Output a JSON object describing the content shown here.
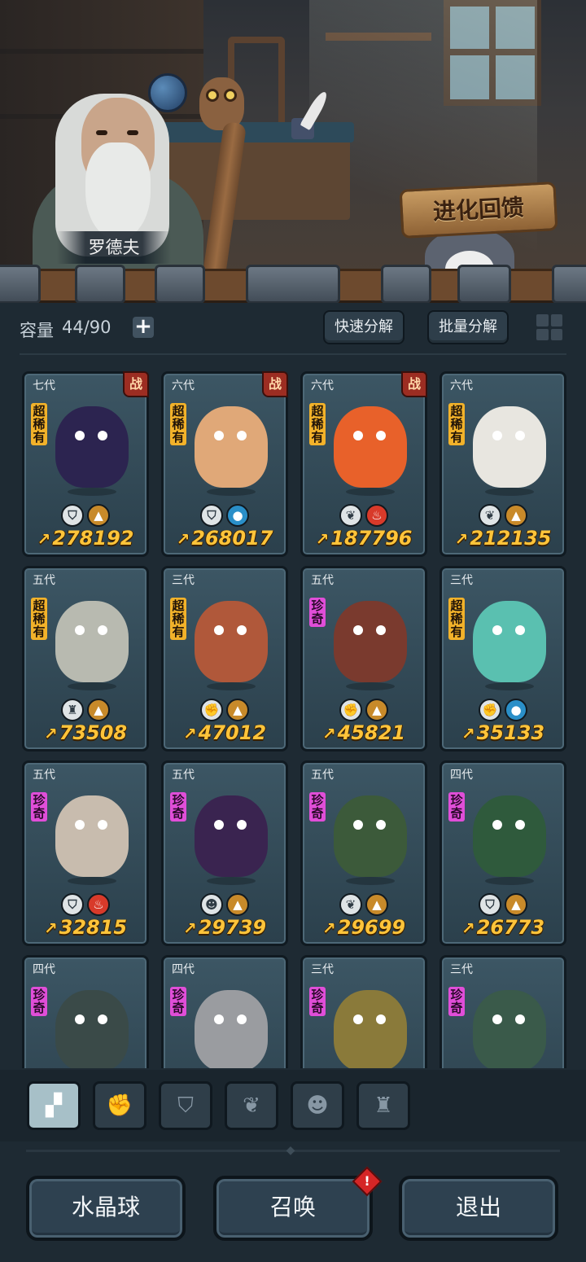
{
  "npc": {
    "name": "罗德夫"
  },
  "evolution_button": {
    "label": "进化回馈"
  },
  "capacity": {
    "label": "容量",
    "value": "44/90",
    "add_label": "+"
  },
  "actions": {
    "quick_decompose": "快速分解",
    "batch_decompose": "批量分解"
  },
  "colors": {
    "super_rare": "#f2b22a",
    "rare": "#e04ed8",
    "power": "#ffc43a",
    "fire": "#d83a2a",
    "water": "#2a8fc8",
    "earth": "#c88a2a"
  },
  "pets": [
    {
      "gen": "七代",
      "battle": "战",
      "rarity": "超稀有",
      "rarity_class": "super",
      "type_icon": "shield-icon",
      "type_glyph": "⛉",
      "elem_icon": "earth-icon",
      "elem_glyph": "▲",
      "elem_color": "#c88a2a",
      "power": "278192",
      "body": "#2c2450"
    },
    {
      "gen": "六代",
      "battle": "战",
      "rarity": "超稀有",
      "rarity_class": "super",
      "type_icon": "shield-icon",
      "type_glyph": "⛉",
      "elem_icon": "water-icon",
      "elem_glyph": "●",
      "elem_color": "#2a8fc8",
      "power": "268017",
      "body": "#e0a878"
    },
    {
      "gen": "六代",
      "battle": "战",
      "rarity": "超稀有",
      "rarity_class": "super",
      "type_icon": "leaf-icon",
      "type_glyph": "❦",
      "elem_icon": "fire-icon",
      "elem_glyph": "♨",
      "elem_color": "#d83a2a",
      "power": "187796",
      "body": "#e8612a"
    },
    {
      "gen": "六代",
      "battle": "",
      "rarity": "超稀有",
      "rarity_class": "super",
      "type_icon": "leaf-icon",
      "type_glyph": "❦",
      "elem_icon": "earth-icon",
      "elem_glyph": "▲",
      "elem_color": "#c88a2a",
      "power": "212135",
      "body": "#e8e6e0"
    },
    {
      "gen": "五代",
      "battle": "",
      "rarity": "超稀有",
      "rarity_class": "super",
      "type_icon": "tower-icon",
      "type_glyph": "♜",
      "elem_icon": "earth-icon",
      "elem_glyph": "▲",
      "elem_color": "#c88a2a",
      "power": "73508",
      "body": "#b8bab0"
    },
    {
      "gen": "三代",
      "battle": "",
      "rarity": "超稀有",
      "rarity_class": "super",
      "type_icon": "fist-icon",
      "type_glyph": "✊",
      "elem_icon": "earth-icon",
      "elem_glyph": "▲",
      "elem_color": "#c88a2a",
      "power": "47012",
      "body": "#b0583a"
    },
    {
      "gen": "五代",
      "battle": "",
      "rarity": "珍奇",
      "rarity_class": "rare",
      "type_icon": "fist-icon",
      "type_glyph": "✊",
      "elem_icon": "earth-icon",
      "elem_glyph": "▲",
      "elem_color": "#c88a2a",
      "power": "45821",
      "body": "#7a3a2e"
    },
    {
      "gen": "三代",
      "battle": "",
      "rarity": "超稀有",
      "rarity_class": "super",
      "type_icon": "fist-icon",
      "type_glyph": "✊",
      "elem_icon": "water-icon",
      "elem_glyph": "●",
      "elem_color": "#2a8fc8",
      "power": "35133",
      "body": "#5ac0b0"
    },
    {
      "gen": "五代",
      "battle": "",
      "rarity": "珍奇",
      "rarity_class": "rare",
      "type_icon": "shield-icon",
      "type_glyph": "⛉",
      "elem_icon": "fire-icon",
      "elem_glyph": "♨",
      "elem_color": "#d83a2a",
      "power": "32815",
      "body": "#c8bcae"
    },
    {
      "gen": "五代",
      "battle": "",
      "rarity": "珍奇",
      "rarity_class": "rare",
      "type_icon": "skull-icon",
      "type_glyph": "☻",
      "elem_icon": "earth-icon",
      "elem_glyph": "▲",
      "elem_color": "#c88a2a",
      "power": "29739",
      "body": "#3a2450"
    },
    {
      "gen": "五代",
      "battle": "",
      "rarity": "珍奇",
      "rarity_class": "rare",
      "type_icon": "leaf-icon",
      "type_glyph": "❦",
      "elem_icon": "earth-icon",
      "elem_glyph": "▲",
      "elem_color": "#c88a2a",
      "power": "29699",
      "body": "#3c5a3a"
    },
    {
      "gen": "四代",
      "battle": "",
      "rarity": "珍奇",
      "rarity_class": "rare",
      "type_icon": "shield-icon",
      "type_glyph": "⛉",
      "elem_icon": "earth-icon",
      "elem_glyph": "▲",
      "elem_color": "#c88a2a",
      "power": "26773",
      "body": "#2f5a3c"
    },
    {
      "gen": "四代",
      "battle": "",
      "rarity": "珍奇",
      "rarity_class": "rare",
      "type_icon": "",
      "type_glyph": "",
      "elem_icon": "",
      "elem_glyph": "",
      "elem_color": "",
      "power": "",
      "body": "#3a4a48"
    },
    {
      "gen": "四代",
      "battle": "",
      "rarity": "珍奇",
      "rarity_class": "rare",
      "type_icon": "",
      "type_glyph": "",
      "elem_icon": "",
      "elem_glyph": "",
      "elem_color": "",
      "power": "",
      "body": "#9a9ca0"
    },
    {
      "gen": "三代",
      "battle": "",
      "rarity": "珍奇",
      "rarity_class": "rare",
      "type_icon": "",
      "type_glyph": "",
      "elem_icon": "",
      "elem_glyph": "",
      "elem_color": "",
      "power": "",
      "body": "#8a7a3a"
    },
    {
      "gen": "三代",
      "battle": "",
      "rarity": "珍奇",
      "rarity_class": "rare",
      "type_icon": "",
      "type_glyph": "",
      "elem_icon": "",
      "elem_glyph": "",
      "elem_color": "",
      "power": "",
      "body": "#3a5a4a"
    }
  ],
  "filter_tabs": [
    {
      "name": "filter-all-icon",
      "glyph": "▞",
      "active": true
    },
    {
      "name": "filter-fist-icon",
      "glyph": "✊",
      "active": false
    },
    {
      "name": "filter-shield-icon",
      "glyph": "⛉",
      "active": false
    },
    {
      "name": "filter-leaf-icon",
      "glyph": "❦",
      "active": false
    },
    {
      "name": "filter-skull-icon",
      "glyph": "☻",
      "active": false
    },
    {
      "name": "filter-tower-icon",
      "glyph": "♜",
      "active": false
    }
  ],
  "bottom": {
    "crystal_ball": "水晶球",
    "summon": "召唤",
    "summon_alert": "!",
    "exit": "退出"
  }
}
